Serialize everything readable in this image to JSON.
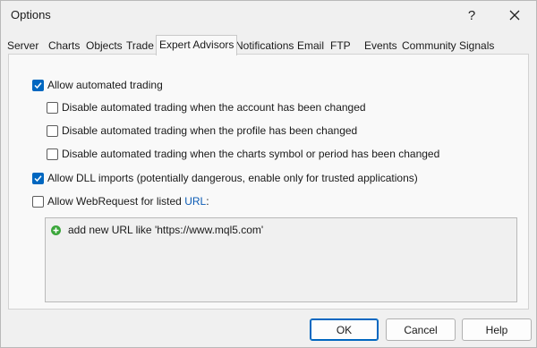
{
  "window": {
    "title": "Options"
  },
  "titlebar": {
    "help_glyph": "?",
    "close_icon": "close-icon"
  },
  "tabs": [
    {
      "label": "Server"
    },
    {
      "label": "Charts"
    },
    {
      "label": "Objects"
    },
    {
      "label": "Trade"
    },
    {
      "label": "Expert Advisors",
      "active": true
    },
    {
      "label": "Notifications"
    },
    {
      "label": "Email"
    },
    {
      "label": "FTP"
    },
    {
      "label": "Events"
    },
    {
      "label": "Community"
    },
    {
      "label": "Signals"
    }
  ],
  "options": {
    "allow_automated": {
      "label": "Allow automated trading",
      "checked": true
    },
    "disable_account": {
      "label": "Disable automated trading when the account has been changed",
      "checked": false
    },
    "disable_profile": {
      "label": "Disable automated trading when the profile has been changed",
      "checked": false
    },
    "disable_symbol": {
      "label": "Disable automated trading when the charts symbol or period has been changed",
      "checked": false
    },
    "allow_dll": {
      "label": "Allow DLL imports (potentially dangerous, enable only for trusted applications)",
      "checked": true
    },
    "allow_webrequest": {
      "label": "Allow WebRequest for listed ",
      "link": "URL",
      "suffix": ":",
      "checked": false
    }
  },
  "url_list": {
    "add_label": "add new URL like 'https://www.mql5.com'"
  },
  "buttons": {
    "ok": "OK",
    "cancel": "Cancel",
    "help": "Help"
  },
  "colors": {
    "accent": "#0067c0",
    "plus_green": "#3aa63a",
    "link": "#0b5bb5"
  }
}
